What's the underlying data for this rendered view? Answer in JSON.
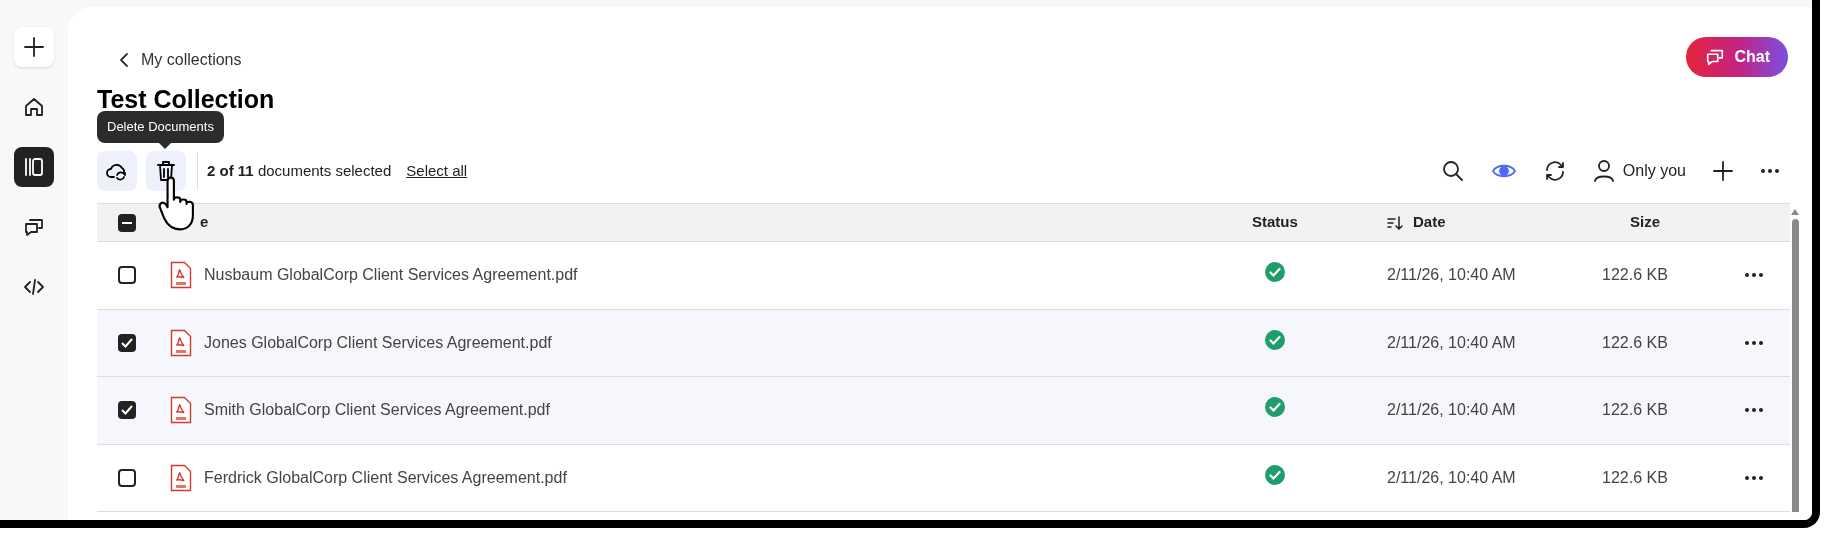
{
  "sidebar": {
    "items": [
      {
        "kind": "new",
        "selected": false
      },
      {
        "kind": "home",
        "selected": false
      },
      {
        "kind": "library",
        "selected": true
      },
      {
        "kind": "chat",
        "selected": false
      },
      {
        "kind": "code",
        "selected": false
      }
    ]
  },
  "back_link": "My collections",
  "chat_button": "Chat",
  "title": "Test Collection",
  "tooltip": "Delete Documents",
  "selection": {
    "summary_count": "2 of 11",
    "summary_text": "documents selected",
    "select_all": "Select all"
  },
  "toolbar": [
    {
      "kind": "search",
      "active": false
    },
    {
      "kind": "view",
      "active": true
    },
    {
      "kind": "sync",
      "active": false
    },
    {
      "kind": "share",
      "label": "Only you",
      "active": false
    },
    {
      "kind": "add",
      "active": false
    },
    {
      "kind": "more",
      "active": false
    }
  ],
  "table": {
    "header_checkbox": {
      "indeterminate": true
    },
    "columns": [
      "e",
      "Status",
      "Date",
      "Size"
    ],
    "rows": [
      {
        "name": "Nusbaum GlobalCorp Client Services Agreement.pdf",
        "selected": false,
        "status_ok": true,
        "date": "2/11/26, 10:40 AM",
        "size": "122.6 KB"
      },
      {
        "name": "Jones GlobalCorp Client Services Agreement.pdf",
        "selected": true,
        "status_ok": true,
        "date": "2/11/26, 10:40 AM",
        "size": "122.6 KB"
      },
      {
        "name": "Smith GlobalCorp Client Services Agreement.pdf",
        "selected": true,
        "status_ok": true,
        "date": "2/11/26, 10:40 AM",
        "size": "122.6 KB"
      },
      {
        "name": "Ferdrick GlobalCorp Client Services Agreement.pdf",
        "selected": false,
        "status_ok": true,
        "date": "2/11/26, 10:40 AM",
        "size": "122.6 KB"
      }
    ]
  }
}
